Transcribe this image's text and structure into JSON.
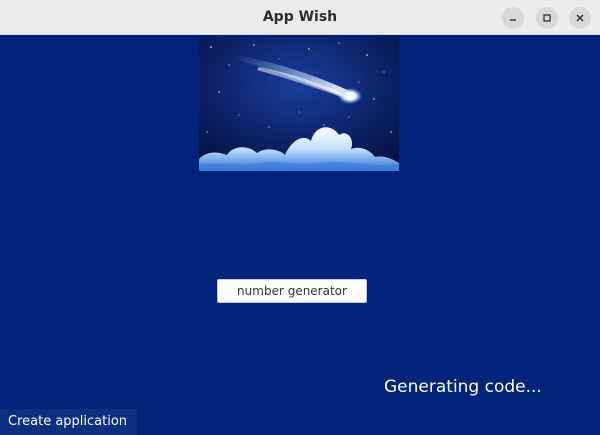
{
  "window": {
    "title": "App Wish",
    "controls": [
      "minimize-icon",
      "maximize-icon",
      "close-icon"
    ]
  },
  "main": {
    "hero_image": "night-sky-comet-over-clouds",
    "generator_button_label": "number generator",
    "status_text": "Generating code...",
    "create_button_label": "Create application"
  },
  "colors": {
    "background": "#01237a",
    "titlebar": "#ebebeb",
    "status_text": "#ffffff",
    "create_button": "#0d2f82"
  }
}
